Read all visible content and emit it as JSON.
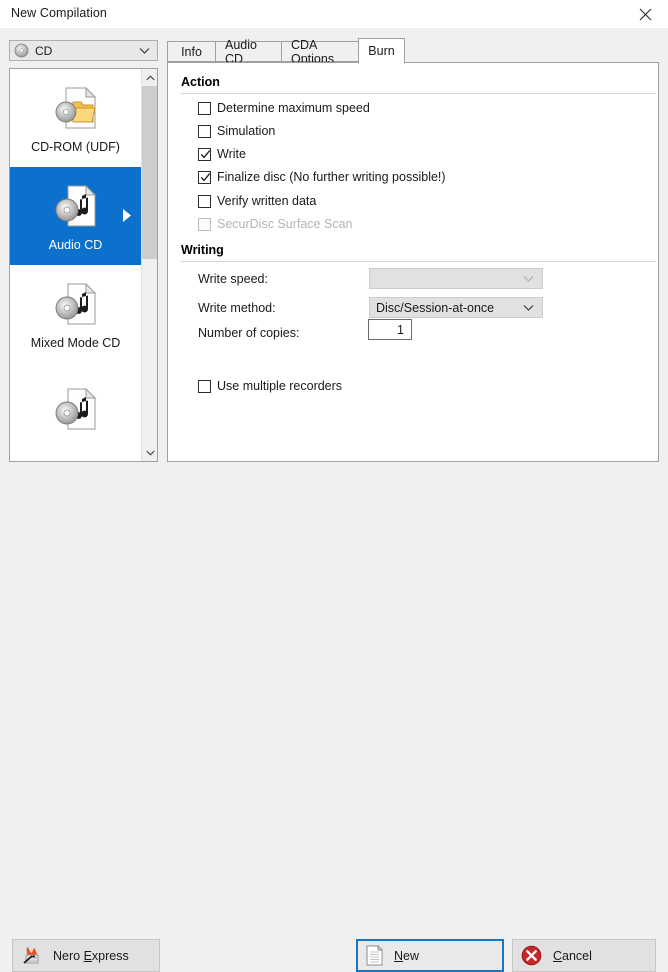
{
  "window": {
    "title": "New Compilation",
    "close_icon": "close-icon"
  },
  "device_combo": {
    "value": "CD",
    "icon": "cd-disc-icon",
    "arrow_icon": "chevron-down-icon"
  },
  "compilation_list": {
    "items": [
      {
        "label": "CD-ROM (UDF)",
        "icon": "cd-folder-icon",
        "selected": false
      },
      {
        "label": "Audio CD",
        "icon": "cd-music-icon",
        "selected": true
      },
      {
        "label": "Mixed Mode CD",
        "icon": "cd-music-icon",
        "selected": false
      },
      {
        "label": "",
        "icon": "cd-music-icon",
        "selected": false
      }
    ],
    "scroll_up_icon": "chevron-up-icon",
    "scroll_down_icon": "chevron-down-icon"
  },
  "tabs": [
    {
      "label": "Info",
      "active": false
    },
    {
      "label": "Audio CD",
      "active": false
    },
    {
      "label": "CDA Options",
      "active": false
    },
    {
      "label": "Burn",
      "active": true
    }
  ],
  "burn_panel": {
    "action": {
      "heading": "Action",
      "checkboxes": [
        {
          "label": "Determine maximum speed",
          "checked": false,
          "enabled": true
        },
        {
          "label": "Simulation",
          "checked": false,
          "enabled": true
        },
        {
          "label": "Write",
          "checked": true,
          "enabled": true
        },
        {
          "label": "Finalize disc (No further writing possible!)",
          "checked": true,
          "enabled": true
        },
        {
          "label": "Verify written data",
          "checked": false,
          "enabled": true
        },
        {
          "label": "SecurDisc Surface Scan",
          "checked": false,
          "enabled": false
        }
      ]
    },
    "writing": {
      "heading": "Writing",
      "write_speed": {
        "label": "Write speed:",
        "value": "",
        "enabled": false
      },
      "write_method": {
        "label": "Write method:",
        "value": "Disc/Session-at-once",
        "enabled": true
      },
      "number_of_copies": {
        "label": "Number of copies:",
        "value": "1"
      },
      "use_multiple_recorders": {
        "label": "Use multiple recorders",
        "checked": false
      }
    }
  },
  "buttons": {
    "nero_express": {
      "text_before": "Nero ",
      "accel": "E",
      "text_after": "xpress",
      "icon": "nero-burn-icon"
    },
    "new": {
      "accel": "N",
      "text_after": "ew",
      "icon": "new-document-icon",
      "focused": true
    },
    "cancel": {
      "accel": "C",
      "text_after": "ancel",
      "icon": "cancel-circle-icon"
    }
  },
  "colors": {
    "selection_blue": "#0b71cd",
    "focus_blue": "#1478c8",
    "panel_bg": "#f0f0f0",
    "content_bg": "#ffffff",
    "cancel_red": "#c62828"
  }
}
